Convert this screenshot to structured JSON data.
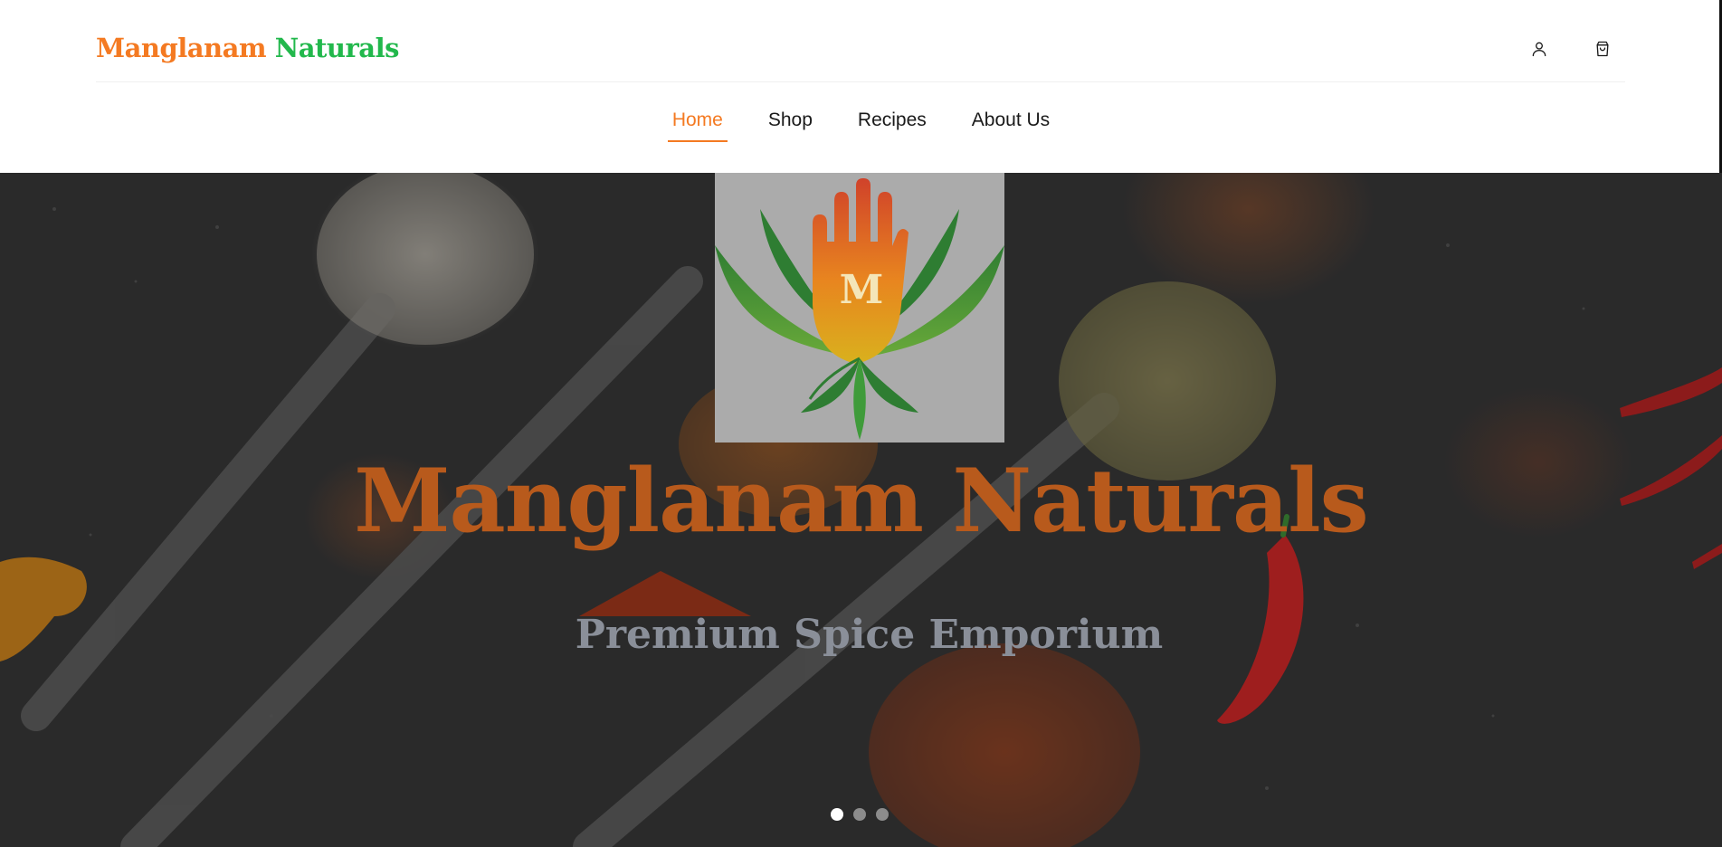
{
  "header": {
    "brand_part1": "Manglanam",
    "brand_part2": "Naturals",
    "account_icon": "user-icon",
    "cart_icon": "shopping-bag-icon"
  },
  "nav": {
    "items": [
      {
        "label": "Home",
        "active": true
      },
      {
        "label": "Shop",
        "active": false
      },
      {
        "label": "Recipes",
        "active": false
      },
      {
        "label": "About Us",
        "active": false
      }
    ]
  },
  "hero": {
    "logo_letter": "M",
    "title": "Manglanam Naturals",
    "subtitle": "Premium Spice Emporium",
    "slides": 3,
    "active_slide": 1
  },
  "colors": {
    "brand_orange": "#f47a22",
    "brand_green": "#22b84c",
    "hero_title": "#b85a1c",
    "hero_subtitle": "#8a8f99"
  }
}
